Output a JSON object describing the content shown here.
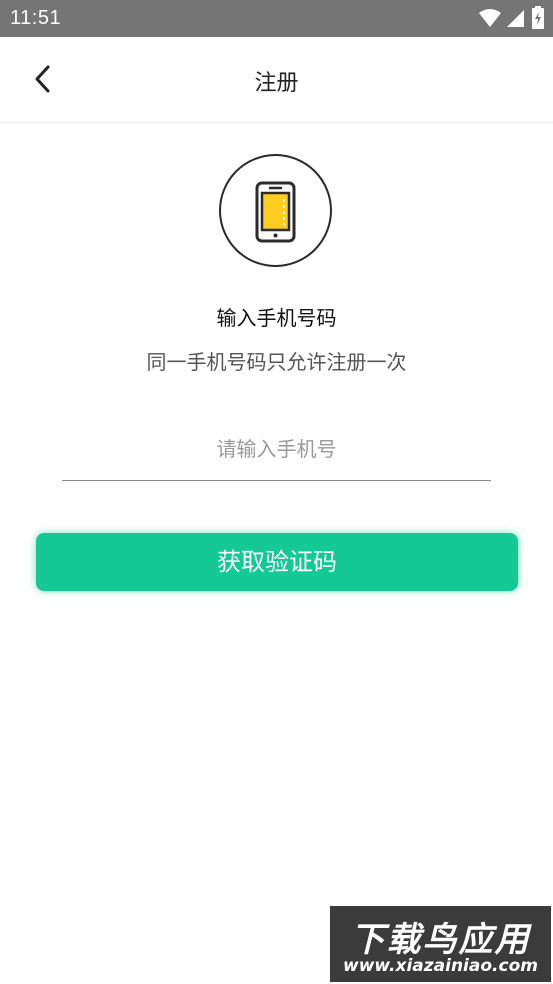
{
  "status_bar": {
    "time": "11:51",
    "icons": [
      "wifi-icon",
      "signal-icon",
      "battery-charging-icon"
    ]
  },
  "header": {
    "back_icon": "chevron-left-icon",
    "title": "注册"
  },
  "main": {
    "illustration_icon": "smartphone-icon",
    "accent_color": "#FFCC22",
    "heading": "输入手机号码",
    "subheading": "同一手机号码只允许注册一次",
    "phone_input": {
      "value": "",
      "placeholder": "请输入手机号"
    },
    "get_code_button": {
      "label": "获取验证码",
      "color": "#15C994"
    }
  },
  "watermark": {
    "title": "下载鸟应用",
    "url": "www.xiazainiao.com"
  }
}
